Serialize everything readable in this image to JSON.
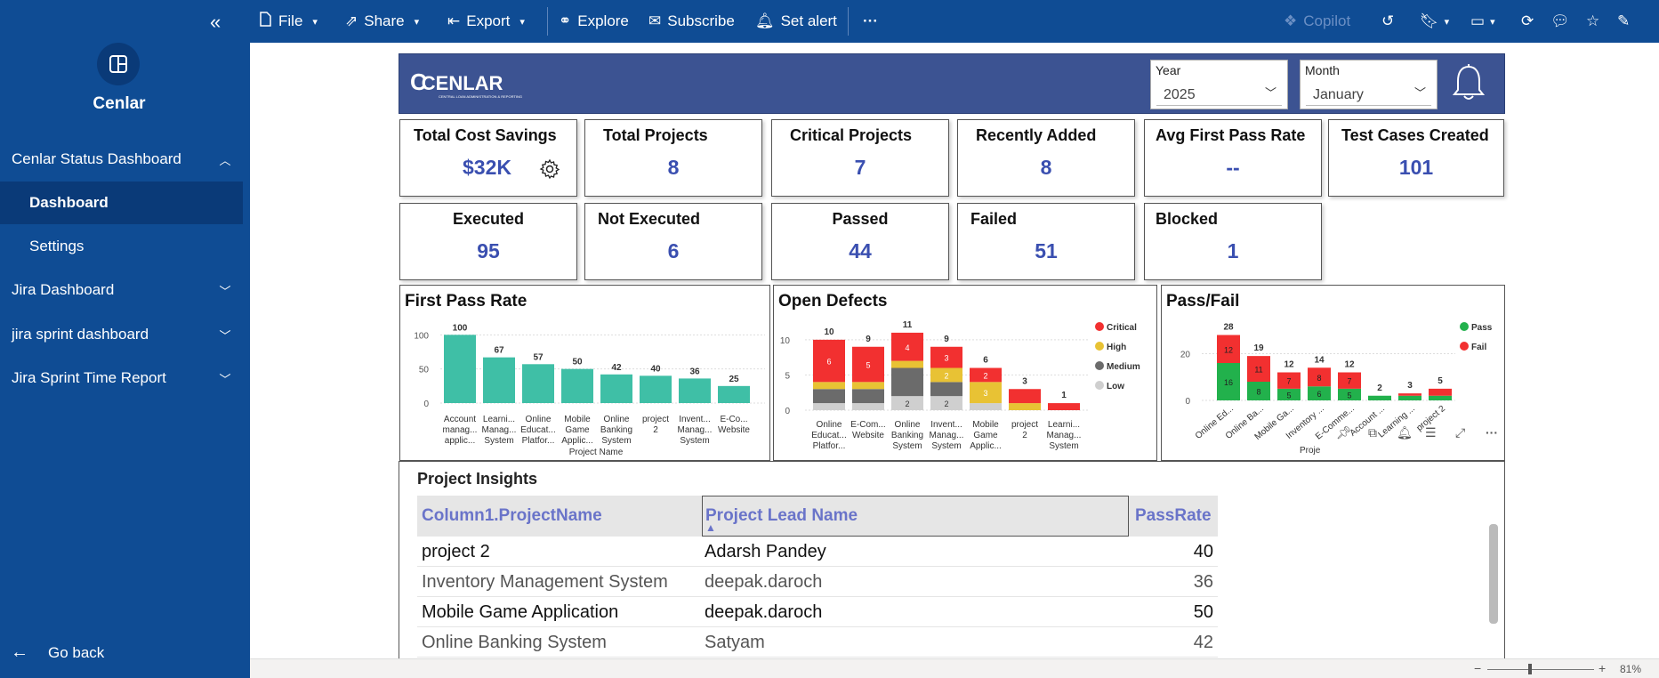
{
  "sidebar": {
    "workspace": "Cenlar",
    "items": [
      {
        "label": "Cenlar Status Dashboard",
        "expanded": true
      },
      {
        "label": "Dashboard",
        "active": true
      },
      {
        "label": "Settings"
      },
      {
        "label": "Jira Dashboard"
      },
      {
        "label": "jira sprint dashboard"
      },
      {
        "label": "Jira Sprint Time Report"
      }
    ],
    "go_back": "Go back"
  },
  "toolbar": {
    "file": "File",
    "share": "Share",
    "export": "Export",
    "explore": "Explore",
    "subscribe": "Subscribe",
    "set_alert": "Set alert",
    "copilot": "Copilot"
  },
  "header": {
    "logo": "CENLAR",
    "logo_tagline": "CENTRAL LOAN ADMINISTRATION & REPORTING",
    "year_label": "Year",
    "year_value": "2025",
    "month_label": "Month",
    "month_value": "January"
  },
  "kpis": [
    {
      "title": "Total Cost Savings",
      "value": "$32K"
    },
    {
      "title": "Total Projects",
      "value": "8"
    },
    {
      "title": "Critical Projects",
      "value": "7"
    },
    {
      "title": "Recently Added",
      "value": "8"
    },
    {
      "title": "Avg First Pass Rate",
      "value": "--"
    },
    {
      "title": "Test Cases Created",
      "value": "101"
    },
    {
      "title": "Executed",
      "value": "95"
    },
    {
      "title": "Not Executed",
      "value": "6"
    },
    {
      "title": "Passed",
      "value": "44"
    },
    {
      "title": "Failed",
      "value": "51"
    },
    {
      "title": "Blocked",
      "value": "1"
    }
  ],
  "chart_data": [
    {
      "type": "bar",
      "title": "First Pass Rate",
      "xlabel": "Project Name",
      "ylabel": "",
      "ylim": [
        0,
        120
      ],
      "yticks": [
        0,
        50,
        100
      ],
      "categories": [
        [
          "Account",
          "manag...",
          "applic..."
        ],
        [
          "Learni...",
          "Manag...",
          "System"
        ],
        [
          "Online",
          "Educat...",
          "Platfor..."
        ],
        [
          "Mobile",
          "Game",
          "Applic..."
        ],
        [
          "Online",
          "Banking",
          "System"
        ],
        [
          "project",
          "2"
        ],
        [
          "Invent...",
          "Manag...",
          "System"
        ],
        [
          "E-Co...",
          "Website"
        ]
      ],
      "values": [
        100,
        67,
        57,
        50,
        42,
        40,
        36,
        25
      ],
      "color": "#3fbfa6"
    },
    {
      "type": "bar",
      "title": "Open Defects",
      "stacked": true,
      "ylim": [
        0,
        12
      ],
      "yticks": [
        0,
        5,
        10
      ],
      "categories": [
        [
          "Online",
          "Educat...",
          "Platfor..."
        ],
        [
          "E-Com...",
          "Website"
        ],
        [
          "Online",
          "Banking",
          "System"
        ],
        [
          "Invent...",
          "Manag...",
          "System"
        ],
        [
          "Mobile",
          "Game",
          "Applic..."
        ],
        [
          "project",
          "2"
        ],
        [
          "Learni...",
          "Manag...",
          "System"
        ]
      ],
      "totals": [
        10,
        9,
        11,
        9,
        6,
        3,
        1
      ],
      "legend": [
        {
          "name": "Critical",
          "color": "#f23030"
        },
        {
          "name": "High",
          "color": "#e8c234"
        },
        {
          "name": "Medium",
          "color": "#6b6b6b"
        },
        {
          "name": "Low",
          "color": "#cfcfcf"
        }
      ],
      "series": [
        {
          "name": "Low",
          "values": [
            1,
            1,
            2,
            2,
            1,
            0,
            0
          ],
          "labels": [
            "",
            "",
            "2",
            "2",
            "",
            "",
            ""
          ]
        },
        {
          "name": "Medium",
          "values": [
            2,
            2,
            4,
            2,
            0,
            0,
            0
          ],
          "labels": [
            "",
            "",
            "",
            "",
            "",
            "",
            ""
          ]
        },
        {
          "name": "High",
          "values": [
            1,
            1,
            1,
            2,
            3,
            1,
            0
          ],
          "labels": [
            "",
            "",
            "",
            "2",
            "3",
            "",
            ""
          ]
        },
        {
          "name": "Critical",
          "values": [
            6,
            5,
            4,
            3,
            2,
            2,
            1
          ],
          "labels": [
            "6",
            "5",
            "4",
            "3",
            "2",
            "",
            ""
          ]
        }
      ]
    },
    {
      "type": "bar",
      "title": "Pass/Fail",
      "stacked": true,
      "xlabel": "Proje",
      "ylim": [
        0,
        32
      ],
      "yticks": [
        0,
        20
      ],
      "categories": [
        "Online Ed...",
        "Online Ba...",
        "Mobile Ga...",
        "Inventory ...",
        "E-Comme...",
        "Account ...",
        "Learning ...",
        "project 2"
      ],
      "totals": [
        28,
        19,
        12,
        14,
        12,
        2,
        3,
        5
      ],
      "legend": [
        {
          "name": "Pass",
          "color": "#22b14c"
        },
        {
          "name": "Fail",
          "color": "#f23030"
        }
      ],
      "series": [
        {
          "name": "Pass",
          "values": [
            16,
            8,
            5,
            6,
            5,
            2,
            2,
            2
          ],
          "labels": [
            "16",
            "8",
            "5",
            "6",
            "5",
            "",
            "",
            ""
          ]
        },
        {
          "name": "Fail",
          "values": [
            12,
            11,
            7,
            8,
            7,
            0,
            1,
            3
          ],
          "labels": [
            "12",
            "11",
            "7",
            "8",
            "7",
            "",
            "",
            ""
          ]
        }
      ]
    }
  ],
  "insights": {
    "title": "Project Insights",
    "columns": [
      "Column1.ProjectName",
      "Project Lead Name",
      "PassRate"
    ],
    "rows": [
      [
        "project 2",
        "Adarsh Pandey",
        "40"
      ],
      [
        "Inventory Management System",
        "deepak.daroch",
        "36"
      ],
      [
        "Mobile Game Application",
        "deepak.daroch",
        "50"
      ],
      [
        "Online Banking System",
        "Satyam",
        "42"
      ]
    ]
  },
  "status": {
    "zoom": "81%"
  }
}
